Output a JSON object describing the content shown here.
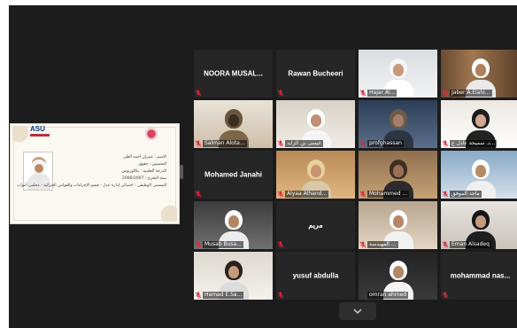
{
  "shared_screen": {
    "logo_text": "ASU",
    "slide_lines": [
      "الاسم : عمران أحمد العلي",
      "التخصص : حقوق",
      "الدرجة العلمية : بكالوريوس",
      "سنة التخرج : 2006/2007",
      "المسمى الوظيفي : اخصائي إدارة عدل - قسم الإجراءات والقوانين الجزائية - مجلس النواب"
    ]
  },
  "participants": [
    {
      "name": "NOORA  MUSAL...",
      "video": false,
      "muted": true
    },
    {
      "name": "Rawan Bucheeri",
      "video": false,
      "muted": true
    },
    {
      "name": "Hajar Al...",
      "video": true,
      "muted": true
    },
    {
      "name": "Jaber A.Elahi...",
      "video": true,
      "muted": true
    },
    {
      "name": "Salman Alota...",
      "video": true,
      "muted": true
    },
    {
      "name": "عيسى بن آلزايد",
      "video": true,
      "muted": true
    },
    {
      "name": "profghassan",
      "video": true,
      "muted": true
    },
    {
      "name": "د. سميحة عادل ع...",
      "video": true,
      "muted": true
    },
    {
      "name": "Mohamed Janahi",
      "video": false,
      "muted": true
    },
    {
      "name": "Alyaa Alhand...",
      "video": true,
      "muted": true
    },
    {
      "name": "Mohammed ...",
      "video": true,
      "muted": true
    },
    {
      "name": "ماجد الموفق",
      "video": true,
      "muted": true
    },
    {
      "name": "Musab Busa...",
      "video": true,
      "muted": true
    },
    {
      "name": "مريم",
      "video": false,
      "muted": true
    },
    {
      "name": "المهندسة ...",
      "video": true,
      "muted": true
    },
    {
      "name": "Eman Alsadeq",
      "video": true,
      "muted": true
    },
    {
      "name": "Hamad E.Sa...",
      "video": true,
      "muted": true
    },
    {
      "name": "yusuf abdulla",
      "video": false,
      "muted": true
    },
    {
      "name": "omran ahmed",
      "video": true,
      "muted": false,
      "active_speaker": true
    },
    {
      "name": "mohammad  nas...",
      "video": false,
      "muted": true
    }
  ],
  "colors": {
    "background": "#1c1c1c",
    "tile": "#262626",
    "active_speaker_border": "#23d959",
    "muted_icon": "#e0283c"
  },
  "icons": {
    "muted": "mic-muted-icon",
    "expand": "chevron-down-icon"
  }
}
